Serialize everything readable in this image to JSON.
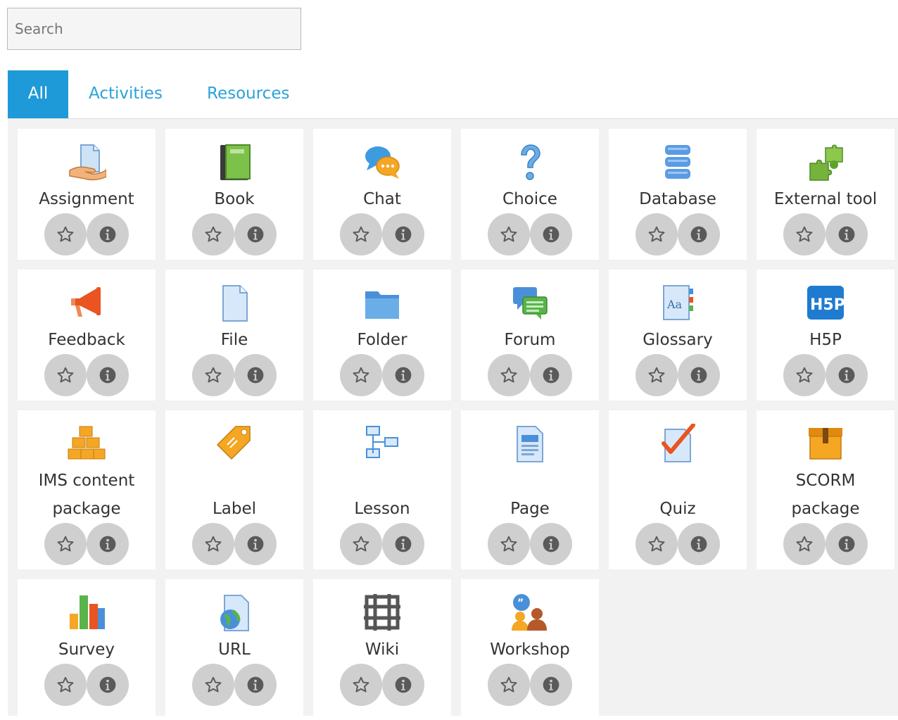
{
  "search": {
    "placeholder": "Search",
    "value": ""
  },
  "tabs": [
    {
      "label": "All",
      "active": true
    },
    {
      "label": "Activities",
      "active": false
    },
    {
      "label": "Resources",
      "active": false
    }
  ],
  "modules": [
    {
      "name": "assignment",
      "lines": [
        "Assignment"
      ],
      "icon": "assignment-icon"
    },
    {
      "name": "book",
      "lines": [
        "Book"
      ],
      "icon": "book-icon"
    },
    {
      "name": "chat",
      "lines": [
        "Chat"
      ],
      "icon": "chat-icon"
    },
    {
      "name": "choice",
      "lines": [
        "Choice"
      ],
      "icon": "choice-icon"
    },
    {
      "name": "database",
      "lines": [
        "Database"
      ],
      "icon": "database-icon"
    },
    {
      "name": "external-tool",
      "lines": [
        "External tool"
      ],
      "icon": "puzzle-icon"
    },
    {
      "name": "feedback",
      "lines": [
        "Feedback"
      ],
      "icon": "megaphone-icon"
    },
    {
      "name": "file",
      "lines": [
        "File"
      ],
      "icon": "file-icon"
    },
    {
      "name": "folder",
      "lines": [
        "Folder"
      ],
      "icon": "folder-icon"
    },
    {
      "name": "forum",
      "lines": [
        "Forum"
      ],
      "icon": "forum-icon"
    },
    {
      "name": "glossary",
      "lines": [
        "Glossary"
      ],
      "icon": "glossary-icon"
    },
    {
      "name": "h5p",
      "lines": [
        "H5P"
      ],
      "icon": "h5p-icon"
    },
    {
      "name": "ims-content-package",
      "lines": [
        "IMS content",
        "package"
      ],
      "icon": "boxes-icon"
    },
    {
      "name": "label",
      "lines": [
        "Label"
      ],
      "icon": "tag-icon"
    },
    {
      "name": "lesson",
      "lines": [
        "Lesson"
      ],
      "icon": "lesson-icon"
    },
    {
      "name": "page",
      "lines": [
        "Page"
      ],
      "icon": "page-icon"
    },
    {
      "name": "quiz",
      "lines": [
        "Quiz"
      ],
      "icon": "quiz-icon"
    },
    {
      "name": "scorm-package",
      "lines": [
        "SCORM",
        "package"
      ],
      "icon": "scorm-box-icon"
    },
    {
      "name": "survey",
      "lines": [
        "Survey"
      ],
      "icon": "bar-chart-icon"
    },
    {
      "name": "url",
      "lines": [
        "URL"
      ],
      "icon": "url-globe-icon"
    },
    {
      "name": "wiki",
      "lines": [
        "Wiki"
      ],
      "icon": "wiki-icon"
    },
    {
      "name": "workshop",
      "lines": [
        "Workshop"
      ],
      "icon": "workshop-icon"
    }
  ],
  "colors": {
    "accent": "#1e9ad9",
    "tab_text": "#2aa3d9",
    "button_bg": "#cfcfcf",
    "button_glyph": "#5a5a5a",
    "panel_bg": "#f2f2f2"
  }
}
